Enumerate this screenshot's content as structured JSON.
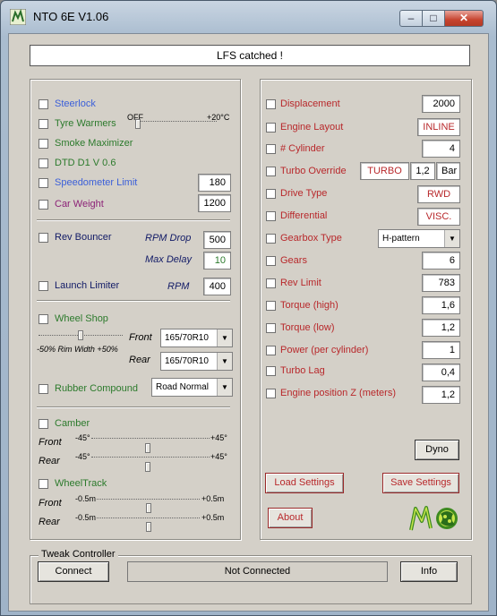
{
  "window": {
    "title": "NTO 6E V1.06",
    "caption_min": "–",
    "caption_max": "□",
    "caption_close": "✕"
  },
  "status": "LFS catched !",
  "left": {
    "steerlock": "Steerlock",
    "tyre_warmers": "Tyre Warmers",
    "tyre_off": "OFF",
    "tyre_max": "+20°C",
    "smoke_maximizer": "Smoke Maximizer",
    "dtd": "DTD D1 V 0.6",
    "speedo_limit": "Speedometer Limit",
    "speedo_value": "180",
    "car_weight": "Car Weight",
    "car_weight_value": "1200",
    "rev_bouncer": "Rev Bouncer",
    "rpm_drop_label": "RPM Drop",
    "rpm_drop_value": "500",
    "max_delay_label": "Max Delay",
    "max_delay_value": "10",
    "launch_limiter": "Launch Limiter",
    "rpm_label": "RPM",
    "rpm_value": "400",
    "wheel_shop": "Wheel Shop",
    "rim_width_label": "-50% Rim Width +50%",
    "front_label": "Front",
    "front_tyre": "165/70R10",
    "rear_label": "Rear",
    "rear_tyre": "165/70R10",
    "rubber_compound": "Rubber Compound",
    "rubber_value": "Road Normal",
    "camber": "Camber",
    "camber_front": "Front",
    "camber_rear": "Rear",
    "camber_min": "-45°",
    "camber_max": "+45°",
    "wheeltrack": "WheelTrack",
    "wt_front": "Front",
    "wt_rear": "Rear",
    "wt_min": "-0.5m",
    "wt_max": "+0.5m"
  },
  "right": {
    "displacement": "Displacement",
    "displacement_value": "2000",
    "engine_layout": "Engine Layout",
    "engine_layout_value": "INLINE",
    "cylinders": "# Cylinder",
    "cylinders_value": "4",
    "turbo_override": "Turbo Override",
    "turbo_value": "TURBO",
    "turbo_boost": "1,2",
    "turbo_unit": "Bar",
    "drive_type": "Drive Type",
    "drive_type_value": "RWD",
    "differential": "Differential",
    "differential_value": "VISC.",
    "gearbox_type": "Gearbox Type",
    "gearbox_value": "H-pattern",
    "gears": "Gears",
    "gears_value": "6",
    "rev_limit": "Rev Limit",
    "rev_limit_value": "783",
    "torque_high": "Torque (high)",
    "torque_high_value": "1,6",
    "torque_low": "Torque (low)",
    "torque_low_value": "1,2",
    "power_per_cyl": "Power (per cylinder)",
    "power_value": "1",
    "turbo_lag": "Turbo Lag",
    "turbo_lag_value": "0,4",
    "engine_pos_z": "Engine position Z (meters)",
    "engine_pos_z_value": "1,2",
    "dyno": "Dyno",
    "load_settings": "Load Settings",
    "save_settings": "Save Settings",
    "about": "About"
  },
  "tweak": {
    "group_title": "Tweak Controller",
    "connect": "Connect",
    "connection_status": "Not Connected",
    "info": "Info"
  },
  "colors": {
    "blue": "#3b5fd9",
    "green": "#2c7a2c",
    "purple": "#8c2277",
    "navy": "#111a66",
    "red": "#b8282b",
    "face": "#d4d0c8"
  },
  "icons": [
    "app-logo-icon",
    "minimize-icon",
    "maximize-icon",
    "close-icon",
    "dropdown-arrow-icon",
    "nto-logo-icon"
  ]
}
